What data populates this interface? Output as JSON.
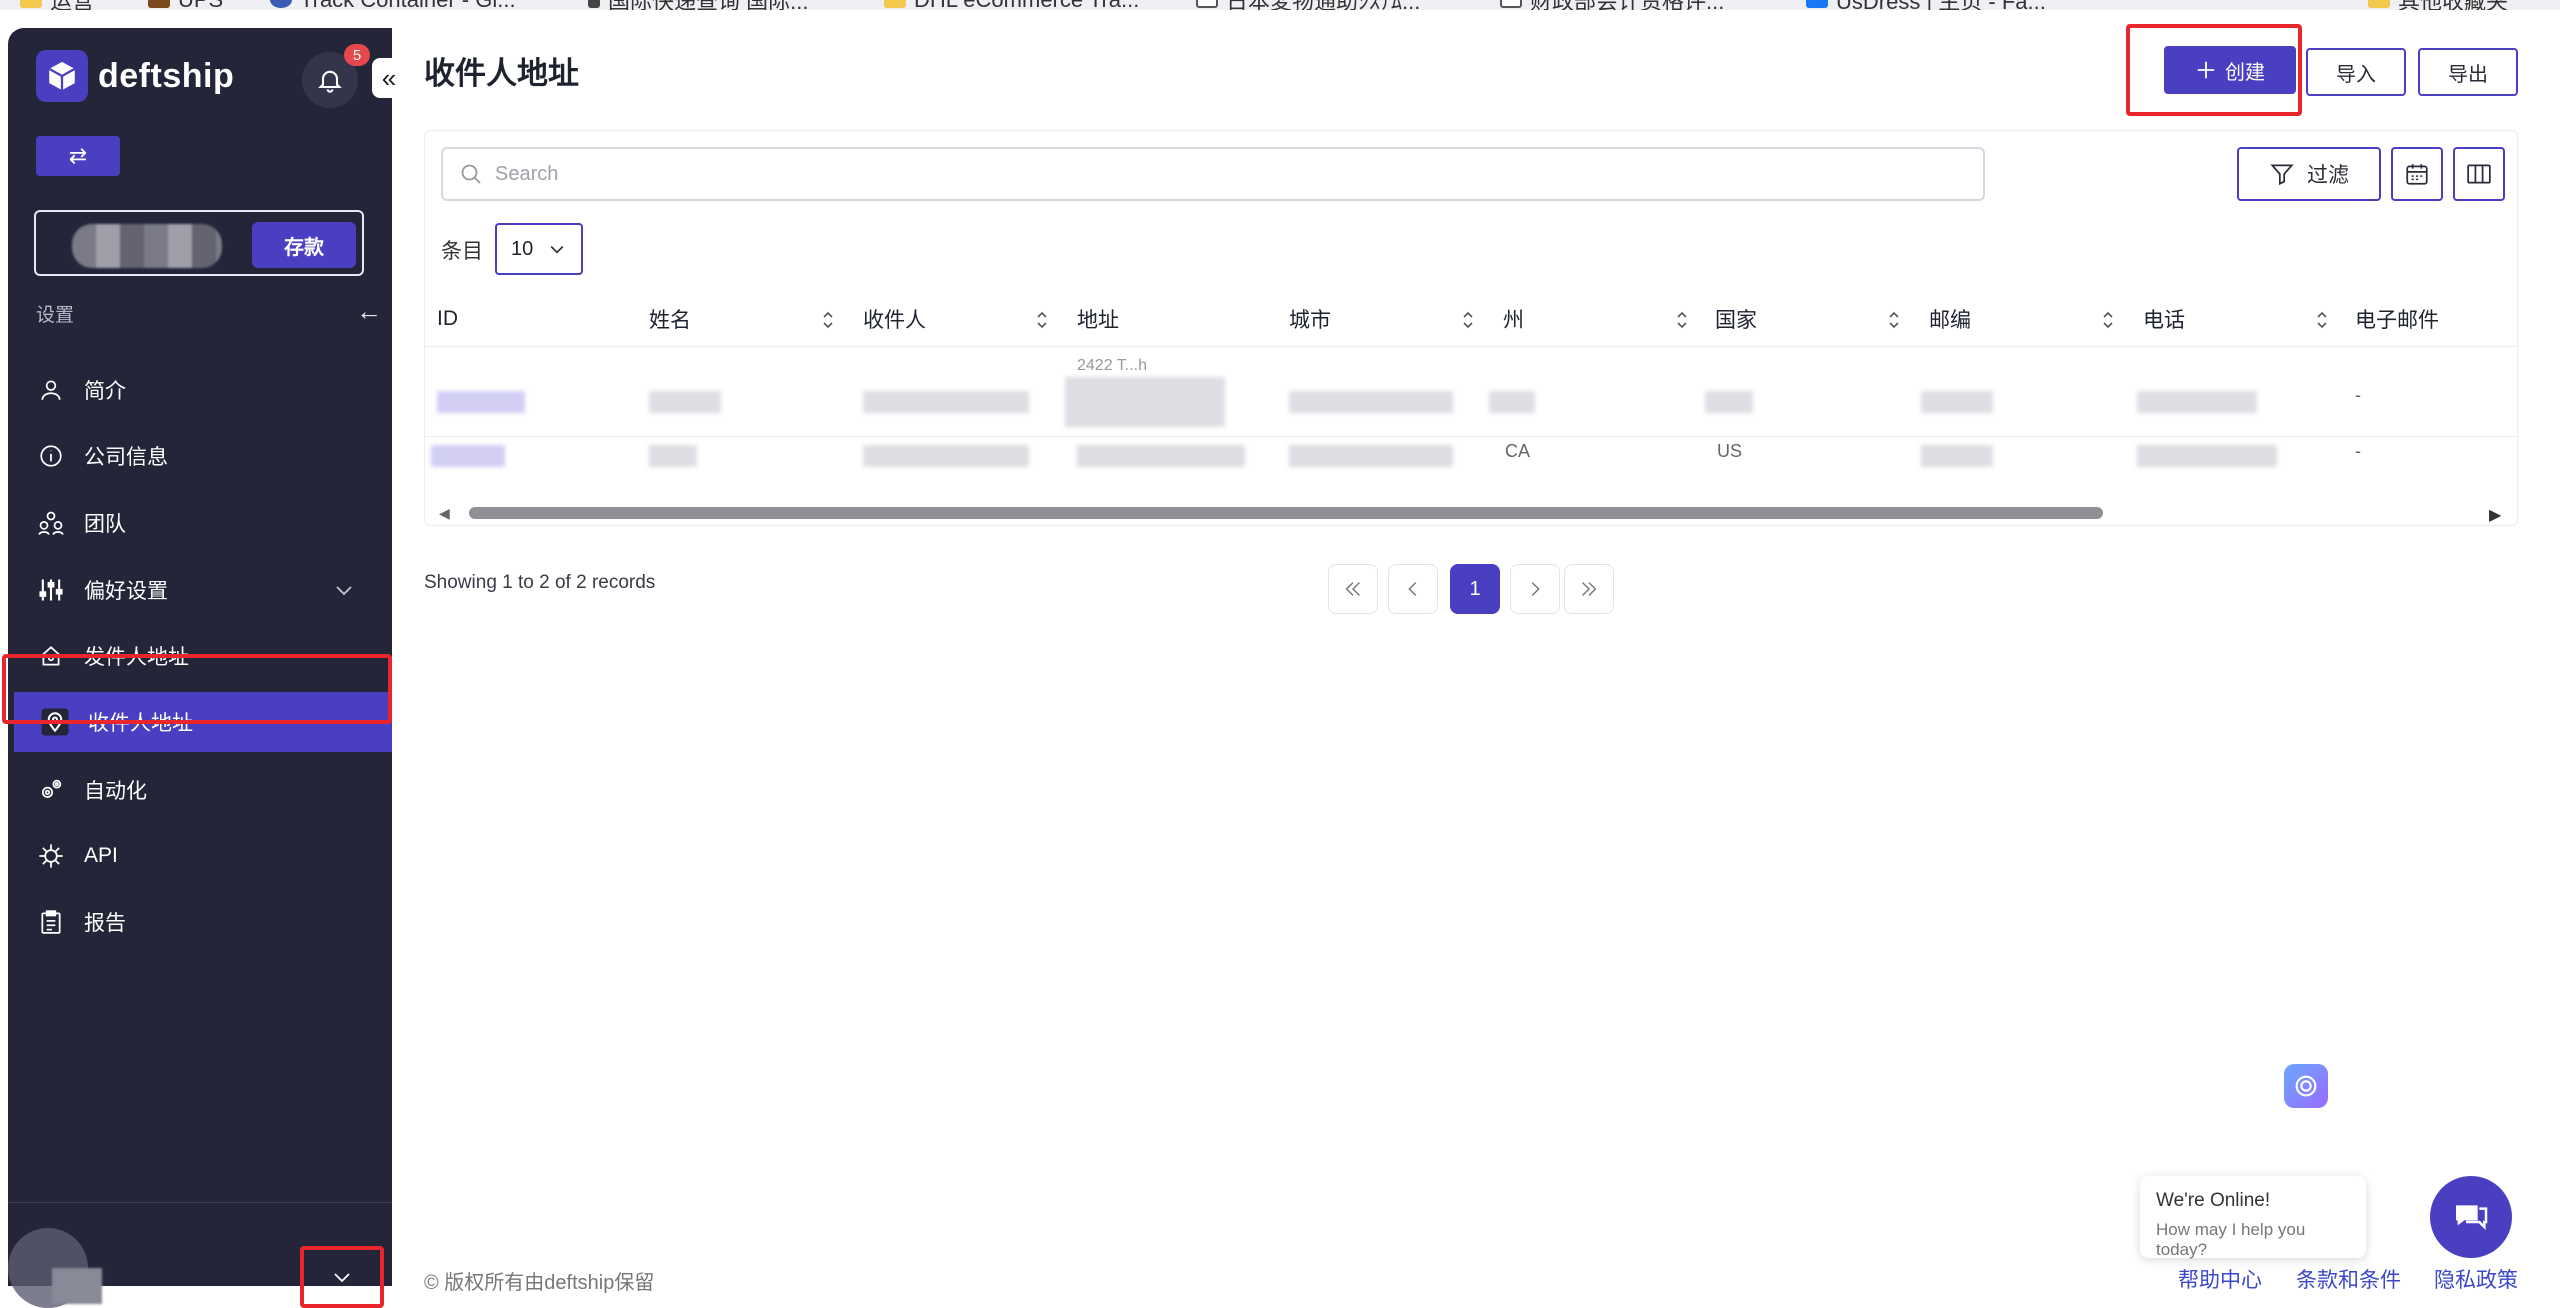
{
  "bookmarks": [
    {
      "label": "运营",
      "icon": "folder-icon"
    },
    {
      "label": "UPS",
      "icon": "ups-icon"
    },
    {
      "label": "Track Container - Gl...",
      "icon": "globe-icon"
    },
    {
      "label": "国际快递查询 国际...",
      "icon": "bookmark-icon"
    },
    {
      "label": "DHL eCommerce Tra...",
      "icon": "folder-icon"
    },
    {
      "label": "日本変物通助ｼｽﾃﾑ...",
      "icon": "doc-icon"
    },
    {
      "label": "财政部会计资格评...",
      "icon": "doc-icon"
    },
    {
      "label": "UsDress | 主页 - Fa...",
      "icon": "facebook-icon"
    },
    {
      "label": "其他收藏夹",
      "icon": "folder-icon"
    }
  ],
  "sidebar": {
    "brand": "deftship",
    "notification_count": "5",
    "deposit_label": "存款",
    "settings_label": "设置",
    "items": [
      {
        "label": "简介",
        "icon": "user-icon"
      },
      {
        "label": "公司信息",
        "icon": "info-icon"
      },
      {
        "label": "团队",
        "icon": "team-icon"
      },
      {
        "label": "偏好设置",
        "icon": "sliders-icon"
      },
      {
        "label": "发件人地址",
        "icon": "home-pin-icon"
      },
      {
        "label": "收件人地址",
        "icon": "map-pin-icon",
        "active": true
      },
      {
        "label": "自动化",
        "icon": "gears-icon"
      },
      {
        "label": "API",
        "icon": "api-icon"
      },
      {
        "label": "报告",
        "icon": "clipboard-icon"
      }
    ]
  },
  "header": {
    "title": "收件人地址",
    "create_label": "创建",
    "import_label": "导入",
    "export_label": "导出"
  },
  "toolbar": {
    "search_placeholder": "Search",
    "filter_label": "过滤",
    "entries_label": "条目",
    "entries_value": "10"
  },
  "table": {
    "columns": [
      "ID",
      "姓名",
      "收件人",
      "地址",
      "城市",
      "州",
      "国家",
      "邮编",
      "电话",
      "电子邮件"
    ],
    "rows": [
      {
        "address_line": "2422 T...h",
        "state": "",
        "country": "",
        "email": "-"
      },
      {
        "address_line": "",
        "state": "CA",
        "country": "US",
        "email": "-"
      }
    ]
  },
  "pagination": {
    "summary": "Showing 1 to 2 of 2 records",
    "current_page": "1"
  },
  "chat": {
    "title": "We're Online!",
    "subtitle": "How may I help you today?"
  },
  "footer": {
    "copyright": "© 版权所有由deftship保留",
    "links": [
      "帮助中心",
      "条款和条件",
      "隐私政策"
    ]
  },
  "colors": {
    "sidebar_bg": "#242539",
    "accent": "#4a3fc0",
    "highlight_outline": "#e8262b"
  }
}
